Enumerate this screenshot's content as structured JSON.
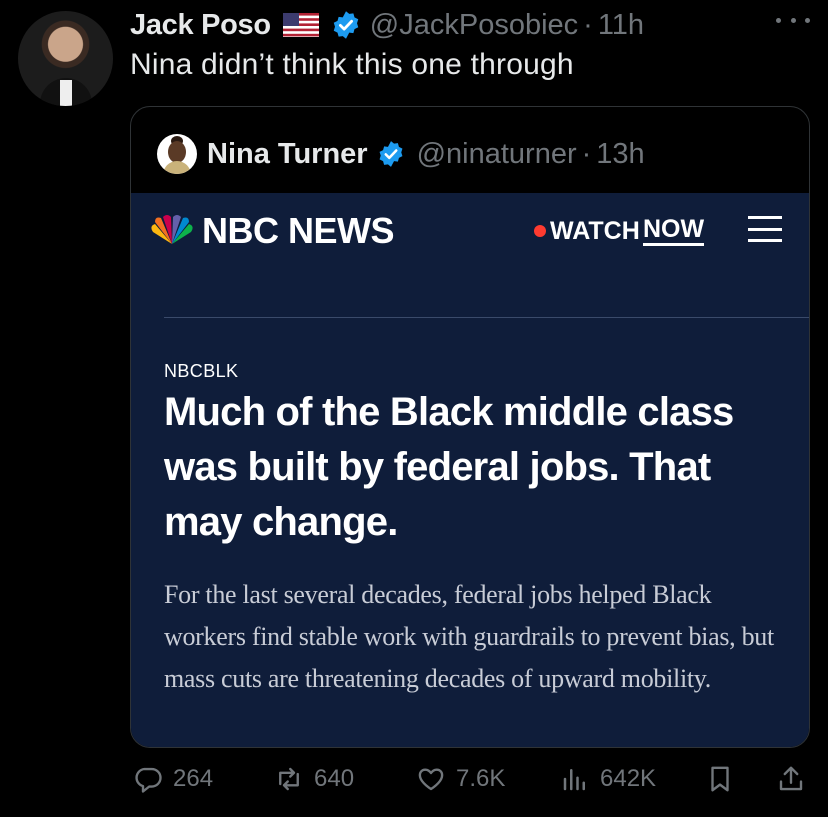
{
  "author": {
    "name": "Jack Poso",
    "handle": "@JackPosobiec",
    "time": "11h"
  },
  "tweet": {
    "text": "Nina didn’t think this one through"
  },
  "quoted": {
    "name": "Nina Turner",
    "handle": "@ninaturner",
    "time": "13h",
    "media": {
      "brand": "NBC NEWS",
      "watch_label": "WATCH",
      "now_label": "NOW",
      "kicker": "NBCBLK",
      "headline": "Much of the Black middle class was built by federal jobs. That may change.",
      "dek": "For the last several decades, federal jobs helped Black workers find stable work with guardrails to prevent bias, but mass cuts are threatening decades of upward mobility."
    }
  },
  "actions": {
    "replies": "264",
    "reposts": "640",
    "likes": "7.6K",
    "views": "642K"
  },
  "colors": {
    "verified": "#1d9bf0",
    "nbc_bg": "#0f1d3a",
    "live_dot": "#ff3b30"
  },
  "icons": [
    "verified-icon",
    "us-flag-icon",
    "more-icon",
    "reply-icon",
    "repost-icon",
    "like-icon",
    "views-icon",
    "bookmark-icon",
    "share-icon",
    "nbc-peacock-icon",
    "menu-icon"
  ]
}
